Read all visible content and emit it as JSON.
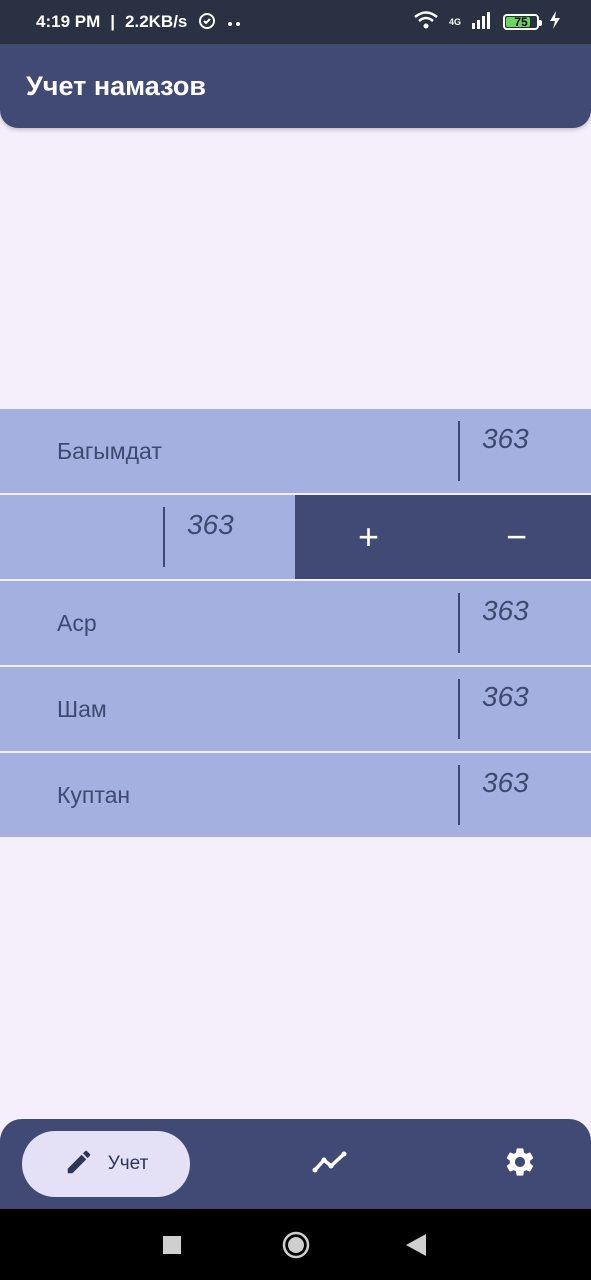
{
  "status_bar": {
    "time": "4:19 PM",
    "speed": "2.2KB/s",
    "network": "4G",
    "battery": "75",
    "battery_level": 0.75
  },
  "app_bar": {
    "title": "Учет намазов"
  },
  "rows": [
    {
      "label": "Багымдат",
      "count": "363"
    },
    {
      "label": "",
      "count": "363"
    },
    {
      "label": "Аср",
      "count": "363"
    },
    {
      "label": "Шам",
      "count": "363"
    },
    {
      "label": "Куптан",
      "count": "363"
    }
  ],
  "swipe_actions": {
    "plus": "+",
    "minus": "−"
  },
  "bottom_nav": {
    "active_label": "Учет",
    "items": [
      {
        "icon": "pencil-icon"
      },
      {
        "icon": "chart-line-icon"
      },
      {
        "icon": "gear-icon"
      }
    ]
  },
  "colors": {
    "accent": "#414a74",
    "row_bg": "#a4b0e0",
    "page_bg": "#f4effa",
    "active_pill": "#e4e0f6"
  }
}
